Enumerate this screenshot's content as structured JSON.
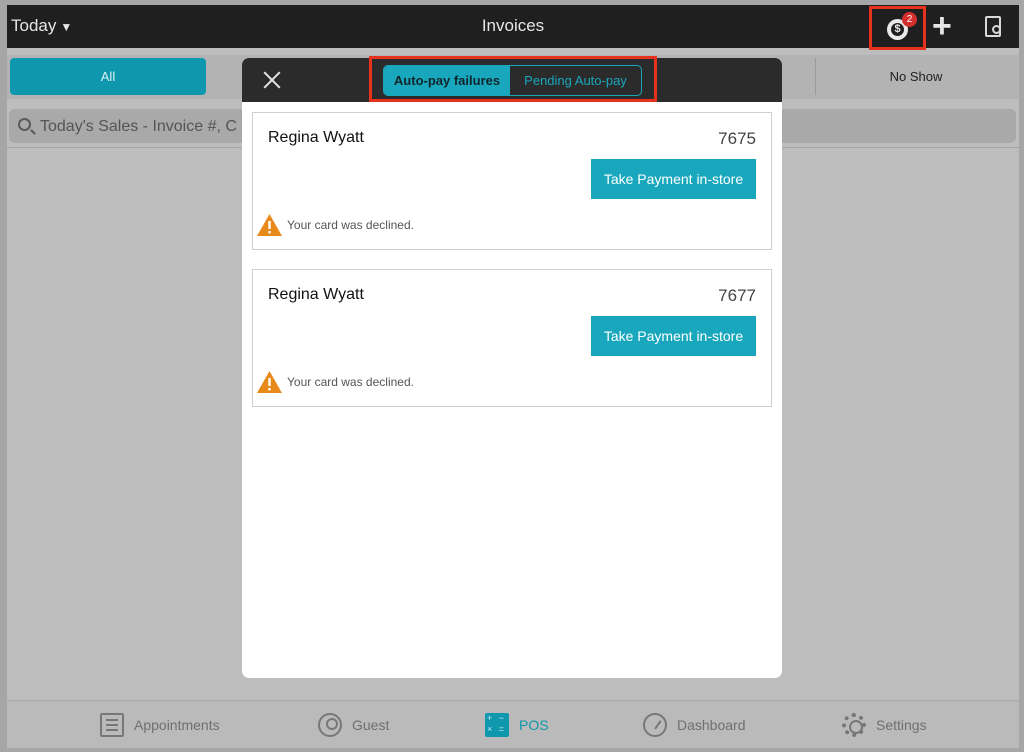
{
  "header": {
    "date_filter": "Today",
    "title": "Invoices",
    "notification_count": "2",
    "icons": [
      "autopay-coin-icon",
      "plus-icon",
      "report-search-icon"
    ]
  },
  "filters": {
    "all_label": "All",
    "no_show_label": "No Show"
  },
  "search": {
    "placeholder": "Today's Sales - Invoice #, C"
  },
  "modal": {
    "tabs": [
      "Auto-pay failures",
      "Pending Auto-pay"
    ],
    "active_tab": "Auto-pay failures",
    "items": [
      {
        "name": "Regina Wyatt",
        "invoice": "7675",
        "button": "Take Payment in-store",
        "message": "Your card was declined."
      },
      {
        "name": "Regina Wyatt",
        "invoice": "7677",
        "button": "Take Payment in-store",
        "message": "Your card was declined."
      }
    ]
  },
  "tabbar": {
    "items": [
      {
        "label": "Appointments",
        "icon": "list-icon"
      },
      {
        "label": "Guest",
        "icon": "user-icon"
      },
      {
        "label": "POS",
        "icon": "calculator-icon"
      },
      {
        "label": "Dashboard",
        "icon": "speedometer-icon"
      },
      {
        "label": "Settings",
        "icon": "gear-icon"
      }
    ],
    "active": "POS"
  },
  "colors": {
    "accent": "#19a7bd",
    "highlight": "#e8321e",
    "warning": "#e8891c"
  }
}
